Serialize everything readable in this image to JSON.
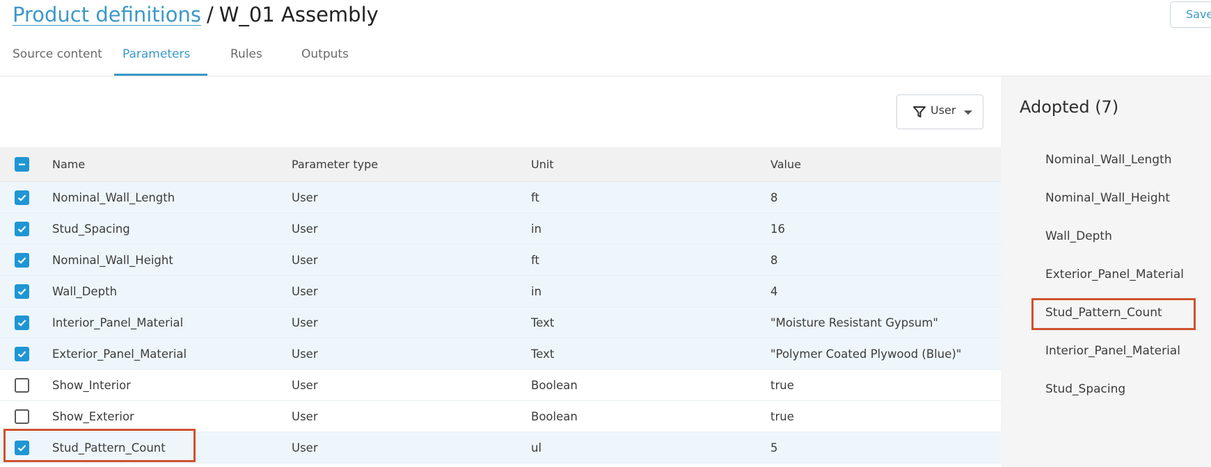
{
  "breadcrumb": {
    "link": "Product definitions",
    "separator": "/",
    "current": "W_01 Assembly"
  },
  "header": {
    "save_label": "Save"
  },
  "tabs": [
    {
      "label": "Source content",
      "active": false
    },
    {
      "label": "Parameters",
      "active": true
    },
    {
      "label": "Rules",
      "active": false
    },
    {
      "label": "Outputs",
      "active": false
    }
  ],
  "filter": {
    "icon": "funnel-icon",
    "label": "User"
  },
  "table": {
    "columns": [
      "Name",
      "Parameter type",
      "Unit",
      "Value"
    ],
    "header_checkbox": "mixed",
    "rows": [
      {
        "name": "Nominal_Wall_Length",
        "type": "User",
        "unit": "ft",
        "value": "8",
        "checked": true
      },
      {
        "name": "Stud_Spacing",
        "type": "User",
        "unit": "in",
        "value": "16",
        "checked": true
      },
      {
        "name": "Nominal_Wall_Height",
        "type": "User",
        "unit": "ft",
        "value": "8",
        "checked": true
      },
      {
        "name": "Wall_Depth",
        "type": "User",
        "unit": "in",
        "value": "4",
        "checked": true
      },
      {
        "name": "Interior_Panel_Material",
        "type": "User",
        "unit": "Text",
        "value": "\"Moisture Resistant Gypsum\"",
        "checked": true
      },
      {
        "name": "Exterior_Panel_Material",
        "type": "User",
        "unit": "Text",
        "value": "\"Polymer Coated Plywood (Blue)\"",
        "checked": true
      },
      {
        "name": "Show_Interior",
        "type": "User",
        "unit": "Boolean",
        "value": "true",
        "checked": false
      },
      {
        "name": "Show_Exterior",
        "type": "User",
        "unit": "Boolean",
        "value": "true",
        "checked": false
      },
      {
        "name": "Stud_Pattern_Count",
        "type": "User",
        "unit": "ul",
        "value": "5",
        "checked": true
      }
    ]
  },
  "adopted": {
    "title": "Adopted (7)",
    "items": [
      "Nominal_Wall_Length",
      "Nominal_Wall_Height",
      "Wall_Depth",
      "Exterior_Panel_Material",
      "Stud_Pattern_Count",
      "Interior_Panel_Material",
      "Stud_Spacing"
    ]
  },
  "colors": {
    "accent": "#3b98c9",
    "checkbox": "#1f96d4",
    "highlight": "#d0512e",
    "selected_row": "#eef6fb"
  }
}
